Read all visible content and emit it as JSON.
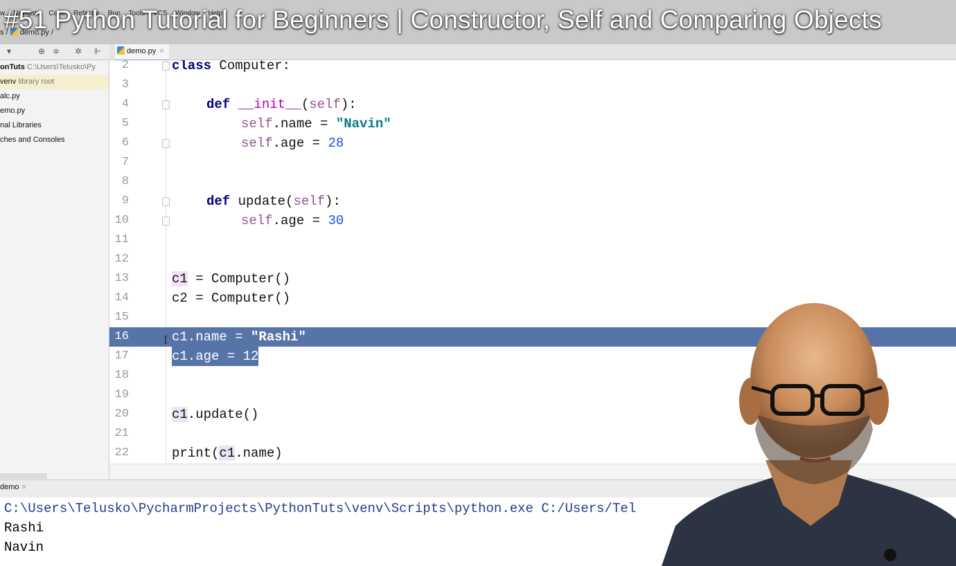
{
  "video": {
    "title": "#51 Python Tutorial for Beginners | Constructor, Self and Comparing Objects"
  },
  "menu": {
    "items": [
      "w",
      "Navigate",
      "Code",
      "Refactor",
      "Run",
      "Tools",
      "VCS",
      "Window",
      "Help"
    ]
  },
  "breadcrumb": {
    "file": "demo.py"
  },
  "project_tree": {
    "items": [
      {
        "name": "onTuts",
        "path": "C:\\Users\\Telusko\\Py"
      },
      {
        "name": "venv",
        "tag": "library root"
      },
      {
        "name": "alc.py"
      },
      {
        "name": "emo.py"
      },
      {
        "name": "nal Libraries"
      },
      {
        "name": "ches and Consoles"
      }
    ]
  },
  "editor": {
    "tab_label": "demo.py",
    "lines": [
      {
        "n": "2",
        "t1": "class",
        "t2": " Computer:"
      },
      {
        "n": "3"
      },
      {
        "n": "4",
        "t1": "def",
        "t2": "__init__",
        "t3": "(",
        "t4": "self",
        "t5": "):"
      },
      {
        "n": "5",
        "t1": "self",
        "t2": ".name = ",
        "t3": "\"Navin\""
      },
      {
        "n": "6",
        "t1": "self",
        "t2": ".age = ",
        "t3": "28"
      },
      {
        "n": "7"
      },
      {
        "n": "8"
      },
      {
        "n": "9",
        "t1": "def",
        "t2": " update(",
        "t3": "self",
        "t4": "):"
      },
      {
        "n": "10",
        "t1": "self",
        "t2": ".age = ",
        "t3": "30"
      },
      {
        "n": "11"
      },
      {
        "n": "12"
      },
      {
        "n": "13",
        "t1": "c1",
        "t2": " = Computer()"
      },
      {
        "n": "14",
        "t1": "c2 = Computer()"
      },
      {
        "n": "15"
      },
      {
        "n": "16",
        "t1": "c1.name = ",
        "t2": "\"Rashi\""
      },
      {
        "n": "17",
        "t1": "c1.age = 12"
      },
      {
        "n": "18"
      },
      {
        "n": "19"
      },
      {
        "n": "20",
        "t1": "c1",
        "t2": ".update()"
      },
      {
        "n": "21"
      },
      {
        "n": "22",
        "t1": "print(",
        "t2": "c1",
        "t3": ".name)"
      }
    ]
  },
  "run": {
    "tab_label": "demo",
    "console": [
      "C:\\Users\\Telusko\\PycharmProjects\\PythonTuts\\venv\\Scripts\\python.exe C:/Users/Tel",
      "Rashi",
      "Navin"
    ]
  },
  "colors": {
    "selection": "#5774a9",
    "keyword": "#000080",
    "string": "#008080",
    "number": "#1750eb",
    "self": "#94558d"
  }
}
